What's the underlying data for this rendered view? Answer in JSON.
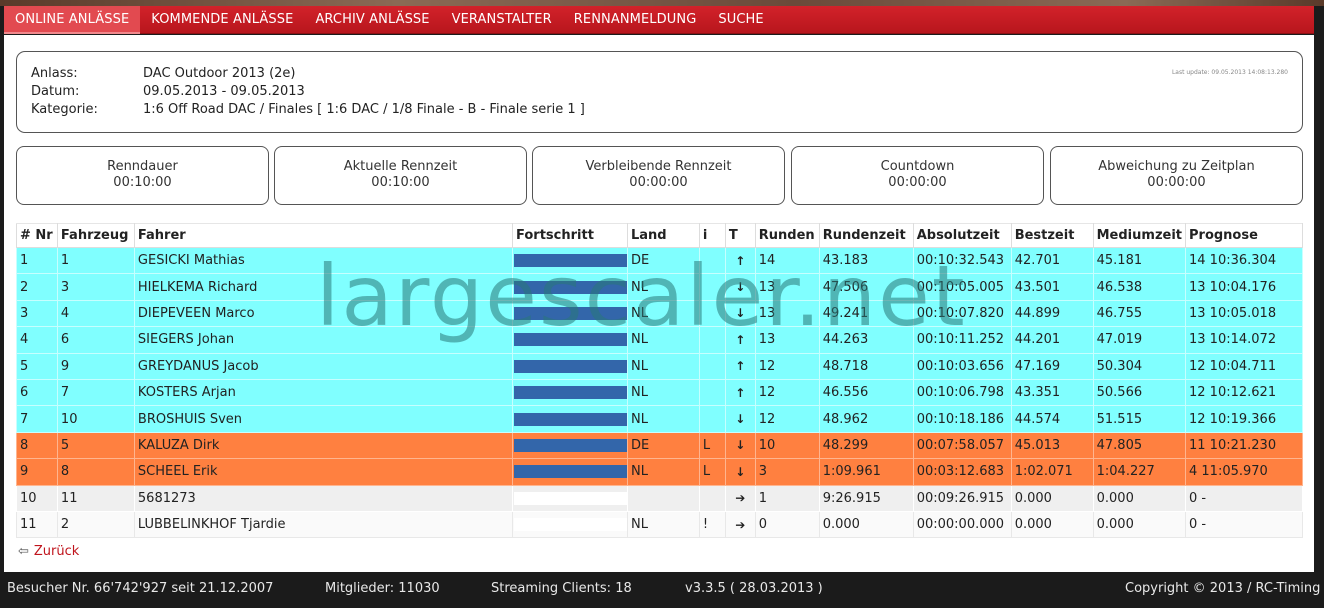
{
  "nav": [
    {
      "label": "ONLINE ANLÄSSE",
      "active": true
    },
    {
      "label": "KOMMENDE ANLÄSSE"
    },
    {
      "label": "ARCHIV ANLÄSSE"
    },
    {
      "label": "VERANSTALTER"
    },
    {
      "label": "RENNANMELDUNG"
    },
    {
      "label": "SUCHE"
    }
  ],
  "event": {
    "anlass_label": "Anlass:",
    "anlass": "DAC Outdoor 2013 (2e)",
    "datum_label": "Datum:",
    "datum": "09.05.2013 - 09.05.2013",
    "kategorie_label": "Kategorie:",
    "kategorie": "1:6 Off Road DAC / Finales [ 1:6 DAC / 1/8 Finale - B - Finale serie 1 ]",
    "last_update": "Last update: 09.05.2013 14:08:13.280"
  },
  "timers": [
    {
      "label": "Renndauer",
      "value": "00:10:00"
    },
    {
      "label": "Aktuelle Rennzeit",
      "value": "00:10:00"
    },
    {
      "label": "Verbleibende Rennzeit",
      "value": "00:00:00"
    },
    {
      "label": "Countdown",
      "value": "00:00:00"
    },
    {
      "label": "Abweichung zu Zeitplan",
      "value": "00:00:00"
    }
  ],
  "table": {
    "headers": [
      "# Nr",
      "Fahrzeug",
      "Fahrer",
      "Fortschritt",
      "Land",
      "i",
      "T",
      "Runden",
      "Rundenzeit",
      "Absolutzeit",
      "Bestzeit",
      "Mediumzeit",
      "Prognose"
    ],
    "rows": [
      {
        "nr": "1",
        "fahrzeug": "1",
        "fahrer": "GESICKI Mathias",
        "progress": 1.0,
        "land": "DE",
        "i": "",
        "trend": "up",
        "runden": "14",
        "rundenzeit": "43.183",
        "absolutzeit": "00:10:32.543",
        "bestzeit": "42.701",
        "mediumzeit": "45.181",
        "prognose": "14 10:36.304",
        "style": "cyan"
      },
      {
        "nr": "2",
        "fahrzeug": "3",
        "fahrer": "HIELKEMA Richard",
        "progress": 1.0,
        "land": "NL",
        "i": "",
        "trend": "down",
        "runden": "13",
        "rundenzeit": "47.506",
        "absolutzeit": "00:10:05.005",
        "bestzeit": "43.501",
        "mediumzeit": "46.538",
        "prognose": "13 10:04.176",
        "style": "cyan"
      },
      {
        "nr": "3",
        "fahrzeug": "4",
        "fahrer": "DIEPEVEEN Marco",
        "progress": 1.0,
        "land": "NL",
        "i": "",
        "trend": "down",
        "runden": "13",
        "rundenzeit": "49.241",
        "absolutzeit": "00:10:07.820",
        "bestzeit": "44.899",
        "mediumzeit": "46.755",
        "prognose": "13 10:05.018",
        "style": "cyan"
      },
      {
        "nr": "4",
        "fahrzeug": "6",
        "fahrer": "SIEGERS Johan",
        "progress": 1.0,
        "land": "NL",
        "i": "",
        "trend": "up",
        "runden": "13",
        "rundenzeit": "44.263",
        "absolutzeit": "00:10:11.252",
        "bestzeit": "44.201",
        "mediumzeit": "47.019",
        "prognose": "13 10:14.072",
        "style": "cyan"
      },
      {
        "nr": "5",
        "fahrzeug": "9",
        "fahrer": "GREYDANUS Jacob",
        "progress": 1.0,
        "land": "NL",
        "i": "",
        "trend": "up",
        "runden": "12",
        "rundenzeit": "48.718",
        "absolutzeit": "00:10:03.656",
        "bestzeit": "47.169",
        "mediumzeit": "50.304",
        "prognose": "12 10:04.711",
        "style": "cyan"
      },
      {
        "nr": "6",
        "fahrzeug": "7",
        "fahrer": "KOSTERS Arjan",
        "progress": 1.0,
        "land": "NL",
        "i": "",
        "trend": "up",
        "runden": "12",
        "rundenzeit": "46.556",
        "absolutzeit": "00:10:06.798",
        "bestzeit": "43.351",
        "mediumzeit": "50.566",
        "prognose": "12 10:12.621",
        "style": "cyan"
      },
      {
        "nr": "7",
        "fahrzeug": "10",
        "fahrer": "BROSHUIS Sven",
        "progress": 1.0,
        "land": "NL",
        "i": "",
        "trend": "down",
        "runden": "12",
        "rundenzeit": "48.962",
        "absolutzeit": "00:10:18.186",
        "bestzeit": "44.574",
        "mediumzeit": "51.515",
        "prognose": "12 10:19.366",
        "style": "cyan"
      },
      {
        "nr": "8",
        "fahrzeug": "5",
        "fahrer": "KALUZA Dirk",
        "progress": 1.0,
        "land": "DE",
        "i": "L",
        "trend": "down",
        "runden": "10",
        "rundenzeit": "48.299",
        "absolutzeit": "00:07:58.057",
        "bestzeit": "45.013",
        "mediumzeit": "47.805",
        "prognose": "11 10:21.230",
        "style": "orange"
      },
      {
        "nr": "9",
        "fahrzeug": "8",
        "fahrer": "SCHEEL Erik",
        "progress": 1.0,
        "land": "NL",
        "i": "L",
        "trend": "down",
        "runden": "3",
        "rundenzeit": "1:09.961",
        "absolutzeit": "00:03:12.683",
        "bestzeit": "1:02.071",
        "mediumzeit": "1:04.227",
        "prognose": "4 11:05.970",
        "style": "orange"
      },
      {
        "nr": "10",
        "fahrzeug": "11",
        "fahrer": "5681273",
        "progress": 0.0,
        "land": "",
        "i": "",
        "trend": "right",
        "runden": "1",
        "rundenzeit": "9:26.915",
        "absolutzeit": "00:09:26.915",
        "bestzeit": "0.000",
        "mediumzeit": "0.000",
        "prognose": "0 -",
        "style": "grey1"
      },
      {
        "nr": "11",
        "fahrzeug": "2",
        "fahrer": "LUBBELINKHOF Tjardie",
        "progress": 0.0,
        "land": "NL",
        "i": "!",
        "trend": "right",
        "runden": "0",
        "rundenzeit": "0.000",
        "absolutzeit": "00:00:00.000",
        "bestzeit": "0.000",
        "mediumzeit": "0.000",
        "prognose": "0 -",
        "style": "grey2"
      }
    ]
  },
  "back_label": "Zurück",
  "watermark": "largescaler.net",
  "footer": {
    "visitors": "Besucher Nr. 66'742'927 seit 21.12.2007",
    "members": "Mitglieder: 11030",
    "streaming": "Streaming Clients: 18",
    "version": "v3.3.5 ( 28.03.2013 )",
    "copyright": "Copyright © 2013 / RC-Timing"
  },
  "colors": {
    "nav_red": "#c41a21",
    "row_cyan": "#80ffff",
    "row_orange": "#ff8040",
    "progress_blue": "#3366aa"
  }
}
